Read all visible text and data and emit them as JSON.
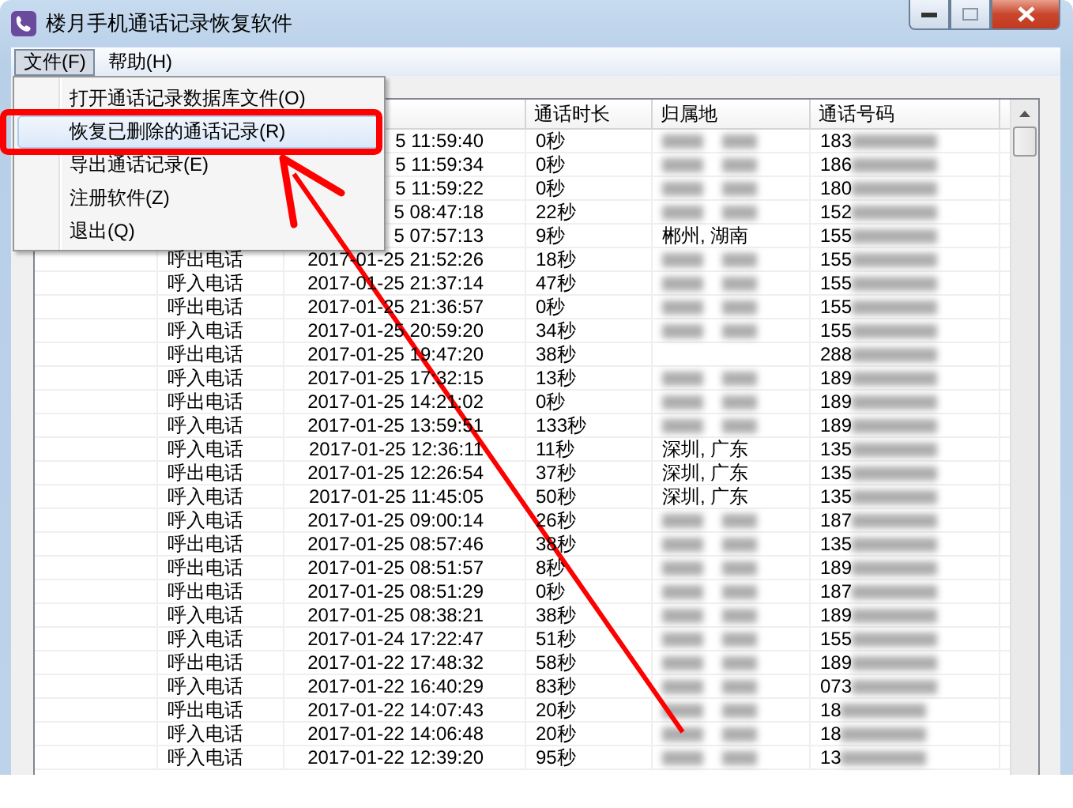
{
  "window": {
    "title": "楼月手机通话记录恢复软件"
  },
  "menubar": [
    {
      "label": "文件(F)",
      "selected": true
    },
    {
      "label": "帮助(H)",
      "selected": false
    }
  ],
  "menu": {
    "items": [
      {
        "label": "打开通话记录数据库文件(O)",
        "selected": false
      },
      {
        "label": "恢复已删除的通话记录(R)",
        "selected": true
      },
      {
        "label": "导出通话记录(E)",
        "selected": false
      },
      {
        "label": "注册软件(Z)",
        "selected": false
      },
      {
        "label": "退出(Q)",
        "selected": false
      }
    ]
  },
  "table": {
    "columns": [
      "通话时长",
      "归属地",
      "通话号码"
    ],
    "rows": [
      {
        "time": "5 11:59:40",
        "duration": "0秒",
        "location": {
          "kind": "blurred"
        },
        "number": "183",
        "number_blurred": true
      },
      {
        "time": "5 11:59:34",
        "duration": "0秒",
        "location": {
          "kind": "blurred"
        },
        "number": "186",
        "number_blurred": true
      },
      {
        "time": "5 11:59:22",
        "duration": "0秒",
        "location": {
          "kind": "blurred"
        },
        "number": "180",
        "number_blurred": true
      },
      {
        "time": "5 08:47:18",
        "duration": "22秒",
        "location": {
          "kind": "blurred"
        },
        "number": "152",
        "number_blurred": true
      },
      {
        "time": "5 07:57:13",
        "duration": "9秒",
        "location": {
          "kind": "text",
          "text": "郴州, 湖南"
        },
        "number": "155",
        "number_blurred": true
      },
      {
        "type": "呼出电话",
        "time": "2017-01-25 21:52:26",
        "duration": "18秒",
        "location": {
          "kind": "blurred"
        },
        "number": "155",
        "number_blurred": true
      },
      {
        "type": "呼入电话",
        "time": "2017-01-25 21:37:14",
        "duration": "47秒",
        "location": {
          "kind": "blurred"
        },
        "number": "155",
        "number_blurred": true
      },
      {
        "type": "呼出电话",
        "time": "2017-01-25 21:36:57",
        "duration": "0秒",
        "location": {
          "kind": "blurred"
        },
        "number": "155",
        "number_blurred": true
      },
      {
        "type": "呼入电话",
        "time": "2017-01-25 20:59:20",
        "duration": "34秒",
        "location": {
          "kind": "blurred"
        },
        "number": "155",
        "number_blurred": true
      },
      {
        "type": "呼出电话",
        "time": "2017-01-25 19:47:20",
        "duration": "38秒",
        "location": {
          "kind": "blank"
        },
        "number": "288",
        "number_blurred": true
      },
      {
        "type": "呼入电话",
        "time": "2017-01-25 17:32:15",
        "duration": "13秒",
        "location": {
          "kind": "blurred"
        },
        "number": "189",
        "number_blurred": true
      },
      {
        "type": "呼出电话",
        "time": "2017-01-25 14:21:02",
        "duration": "0秒",
        "location": {
          "kind": "blurred"
        },
        "number": "189",
        "number_blurred": true
      },
      {
        "type": "呼入电话",
        "time": "2017-01-25 13:59:51",
        "duration": "133秒",
        "location": {
          "kind": "blurred"
        },
        "number": "189",
        "number_blurred": true
      },
      {
        "type": "呼入电话",
        "time": "2017-01-25 12:36:11",
        "duration": "11秒",
        "location": {
          "kind": "text",
          "text": "深圳, 广东"
        },
        "number": "135",
        "number_blurred": true
      },
      {
        "type": "呼出电话",
        "time": "2017-01-25 12:26:54",
        "duration": "37秒",
        "location": {
          "kind": "text",
          "text": "深圳, 广东"
        },
        "number": "135",
        "number_blurred": true
      },
      {
        "type": "呼入电话",
        "time": "2017-01-25 11:45:05",
        "duration": "50秒",
        "location": {
          "kind": "text",
          "text": "深圳, 广东"
        },
        "number": "135",
        "number_blurred": true
      },
      {
        "type": "呼入电话",
        "time": "2017-01-25 09:00:14",
        "duration": "26秒",
        "location": {
          "kind": "blurred"
        },
        "number": "187",
        "number_blurred": true
      },
      {
        "type": "呼出电话",
        "time": "2017-01-25 08:57:46",
        "duration": "38秒",
        "location": {
          "kind": "blurred"
        },
        "number": "135",
        "number_blurred": true
      },
      {
        "type": "呼出电话",
        "time": "2017-01-25 08:51:57",
        "duration": "8秒",
        "location": {
          "kind": "blurred"
        },
        "number": "189",
        "number_blurred": true
      },
      {
        "type": "呼出电话",
        "time": "2017-01-25 08:51:29",
        "duration": "0秒",
        "location": {
          "kind": "blurred"
        },
        "number": "187",
        "number_blurred": true
      },
      {
        "type": "呼入电话",
        "time": "2017-01-25 08:38:21",
        "duration": "38秒",
        "location": {
          "kind": "blurred"
        },
        "number": "189",
        "number_blurred": true
      },
      {
        "type": "呼入电话",
        "time": "2017-01-24 17:22:47",
        "duration": "51秒",
        "location": {
          "kind": "blurred"
        },
        "number": "155",
        "number_blurred": true
      },
      {
        "type": "呼出电话",
        "time": "2017-01-22 17:48:32",
        "duration": "58秒",
        "location": {
          "kind": "blurred"
        },
        "number": "189",
        "number_blurred": true
      },
      {
        "type": "呼入电话",
        "time": "2017-01-22 16:40:29",
        "duration": "83秒",
        "location": {
          "kind": "blurred"
        },
        "number": "073",
        "number_blurred": true
      },
      {
        "type": "呼出电话",
        "time": "2017-01-22 14:07:43",
        "duration": "20秒",
        "location": {
          "kind": "blurred"
        },
        "number": "18",
        "number_blurred": true
      },
      {
        "type": "呼入电话",
        "time": "2017-01-22 14:06:48",
        "duration": "20秒",
        "location": {
          "kind": "blurred"
        },
        "number": "18",
        "number_blurred": true
      },
      {
        "type": "呼入电话",
        "time": "2017-01-22 12:39:20",
        "duration": "95秒",
        "location": {
          "kind": "blurred"
        },
        "number": "13",
        "number_blurred": true
      }
    ]
  }
}
